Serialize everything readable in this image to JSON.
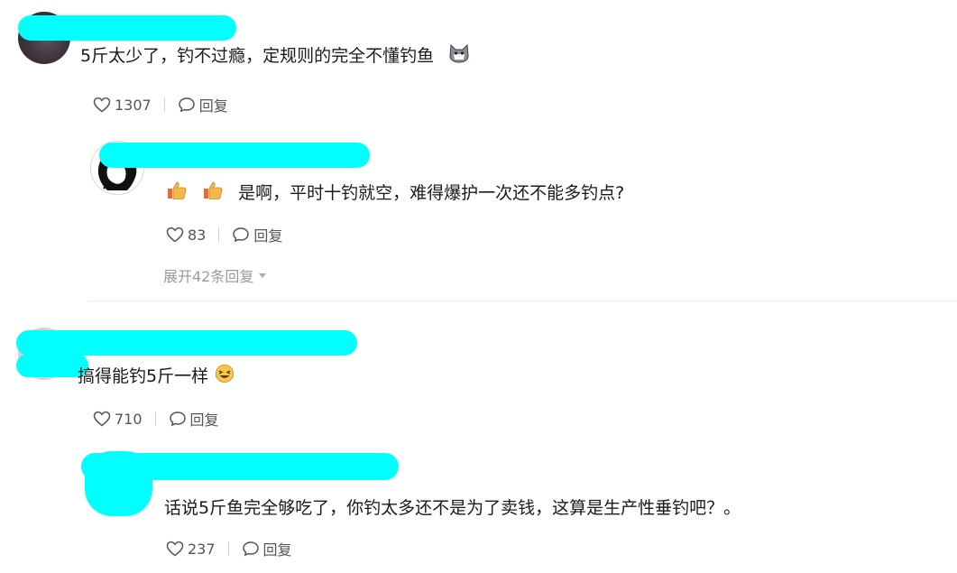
{
  "comments": [
    {
      "text": "5斤太少了，钓不过瘾，定规则的完全不懂钓鱼",
      "emoji": "cat-emoji",
      "likes": "1307",
      "reply_label": "回复",
      "replies": [
        {
          "text": "是啊，平时十钓就空，难得爆护一次还不能多钓点?",
          "prefix_emoji": [
            "thumbs-up-emoji",
            "thumbs-up-emoji"
          ],
          "likes": "83",
          "reply_label": "回复"
        }
      ],
      "expand_label": "展开42条回复"
    },
    {
      "text": "搞得能钓5斤一样",
      "emoji": "laugh-cry-emoji",
      "likes": "710",
      "reply_label": "回复",
      "replies": [
        {
          "text": "话说5斤鱼完全够吃了，你钓太多还不是为了卖钱，这算是生产性垂钓吧？。",
          "likes": "237",
          "reply_label": "回复"
        }
      ]
    }
  ],
  "colors": {
    "redaction": "#00ffff",
    "text": "#1a1a1a",
    "meta": "#555555",
    "muted": "#9a9a9a"
  }
}
